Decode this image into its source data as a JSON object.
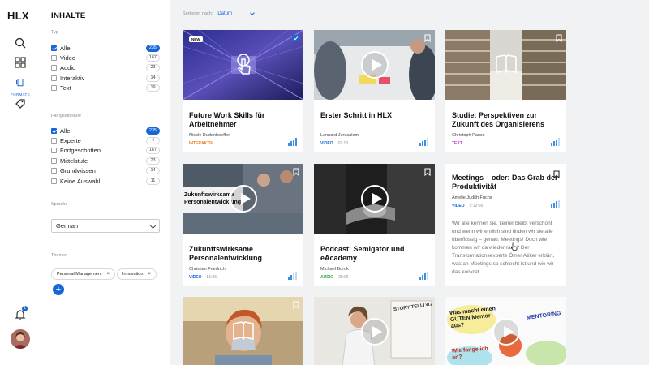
{
  "rail": {
    "logo": "HLX",
    "active_label": "FORMATE",
    "notification_count": "1"
  },
  "panel": {
    "title": "INHALTE",
    "type_heading": "Typ",
    "type_items": [
      {
        "label": "Alle",
        "count": "235",
        "checked": true
      },
      {
        "label": "Video",
        "count": "167",
        "checked": false
      },
      {
        "label": "Audio",
        "count": "23",
        "checked": false
      },
      {
        "label": "Interaktiv",
        "count": "14",
        "checked": false
      },
      {
        "label": "Text",
        "count": "19",
        "checked": false
      }
    ],
    "level_heading": "Fähigkeitsstufe",
    "level_items": [
      {
        "label": "Alle",
        "count": "235",
        "checked": true
      },
      {
        "label": "Experte",
        "count": "4",
        "checked": false
      },
      {
        "label": "Fortgeschritten",
        "count": "167",
        "checked": false
      },
      {
        "label": "Mittelstufe",
        "count": "23",
        "checked": false
      },
      {
        "label": "Grundwissen",
        "count": "14",
        "checked": false
      },
      {
        "label": "Keine Auswahl",
        "count": "11",
        "checked": false
      }
    ],
    "language_heading": "Sprache",
    "language_value": "German",
    "topics_heading": "Themen",
    "topics": [
      "Personal Management",
      "Innovation"
    ],
    "remove_glyph": "×",
    "add_glyph": "+"
  },
  "sort": {
    "label": "Sortieren nach:",
    "value": "Datum"
  },
  "cards": [
    {
      "title": "Future Work Skills für Arbeitnehmer",
      "author": "Nicole Dudenhoeffer",
      "type": "INTERAKTIV",
      "duration": "",
      "new_label": "NEW",
      "color": "#f07b1d"
    },
    {
      "title": "Erster Schritt in HLX",
      "author": "Lennard Jerusalem",
      "type": "VIDEO",
      "duration": "02:13",
      "color": "#1766d6"
    },
    {
      "title": "Studie: Perspektiven zur Zukunft des Organisierens",
      "author": "Christoph Pause",
      "type": "TEXT",
      "duration": "",
      "color": "#b234d6"
    },
    {
      "title": "Zukunftswirksame Personalentwicklung",
      "author": "Christian Friedrich",
      "type": "VIDEO",
      "duration": "51:06",
      "color": "#1766d6"
    },
    {
      "title": "Podcast: Semigator und eAcademy",
      "author": "Michael Burok",
      "type": "AUDIO",
      "duration": "28:06",
      "color": "#3aa64a"
    },
    {
      "title": "Meetings – oder: Das Grab der Produktivität",
      "author": "Amelie Judith Fuchs",
      "type": "VIDEO",
      "duration": "5:12:06",
      "color": "#1766d6",
      "excerpt": "Wir alle kennen sie, keiner bleibt verschont und wenn wir ehrlich sind finden wir sie alle überflüssig – genau: Meetings! Doch wie kommen wir da wieder raus? Der Transformationsexperte Ömer Atiker erklärt, was an Meetings so schlecht ist und wie wir das konkret ..."
    }
  ],
  "thumb_texts": {
    "slide_title": "Zukunftswirksame Personalentwick ung",
    "whiteboard_1": "Was macht einen GUTEN Mentor aus?",
    "whiteboard_2": "MENTORING",
    "whiteboard_3": "Wie fange ich an?",
    "story": "STORY TELLING"
  }
}
